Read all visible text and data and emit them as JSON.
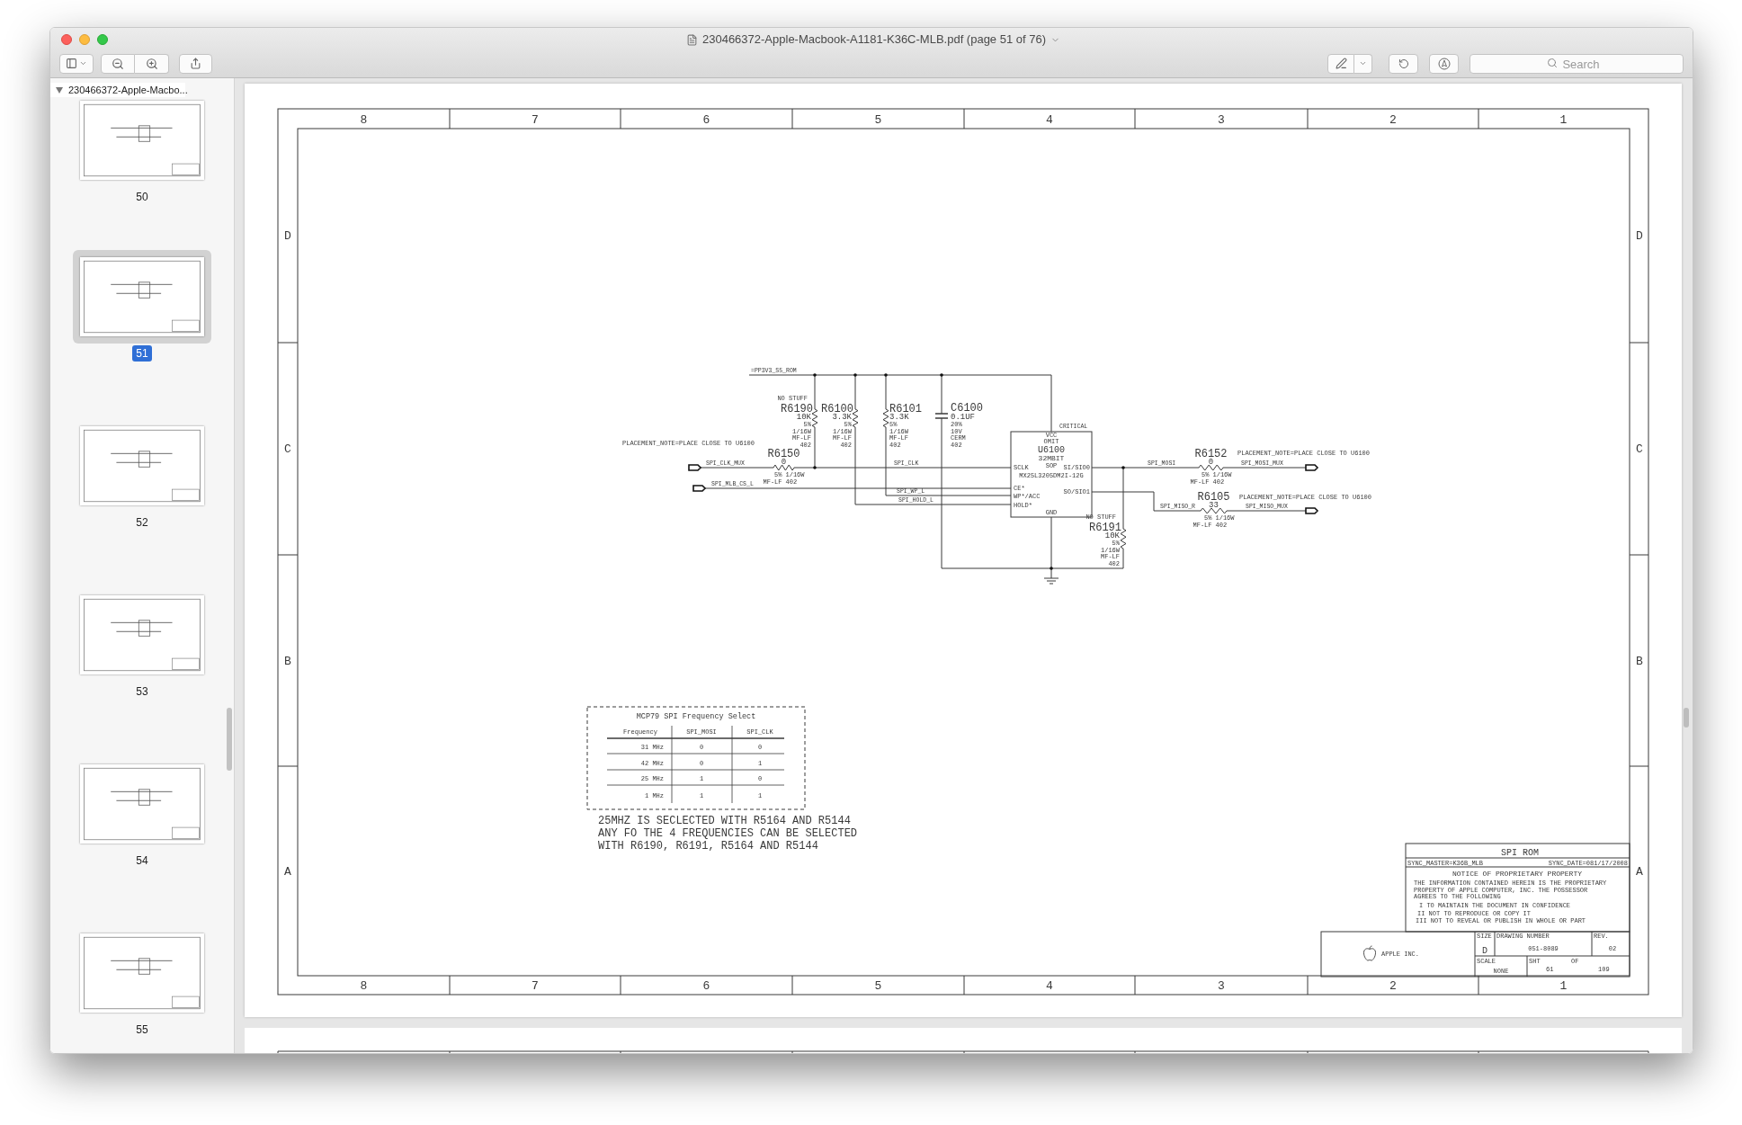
{
  "window": {
    "title": "230466372-Apple-Macbook-A1181-K36C-MLB.pdf (page 51 of 76)"
  },
  "toolbar": {
    "search": {
      "placeholder": "Search"
    }
  },
  "sidebar": {
    "document": "230466372-Apple-Macbo...",
    "pages": [
      {
        "label": "50",
        "selected": false
      },
      {
        "label": "51",
        "selected": true
      },
      {
        "label": "52",
        "selected": false
      },
      {
        "label": "53",
        "selected": false
      },
      {
        "label": "54",
        "selected": false
      },
      {
        "label": "55",
        "selected": false
      }
    ]
  },
  "sheet": {
    "top_zones": [
      "8",
      "7",
      "6",
      "5",
      "4",
      "3",
      "2",
      "1"
    ],
    "bottom_zones": [
      "8",
      "7",
      "6",
      "5",
      "4",
      "3",
      "2",
      "1"
    ],
    "left_zones": [
      "D",
      "C",
      "B",
      "A"
    ],
    "right_zones": [
      "D",
      "C",
      "B",
      "A"
    ]
  },
  "schematic": {
    "nets": [
      "=PP3V3_S5_ROM",
      "SPI_CLK_MUX",
      "SPI_MLB_CS_L",
      "SPI_CLK",
      "SPI_WP_L",
      "SPI_HOLD_L",
      "SPI_MOSI",
      "SPI_MOSI_MUX",
      "SPI_MISO_R",
      "SPI_MISO_MUX"
    ],
    "placement_notes": [
      "PLACEMENT_NOTE=PLACE CLOSE TO U6100",
      "PLACEMENT_NOTE=PLACE CLOSE TO U6100",
      "PLACEMENT_NOTE=PLACE CLOSE TO U6100"
    ],
    "components": [
      {
        "kind": "resistor",
        "ref": "R6190",
        "note": "NO STUFF",
        "value": "10K",
        "specs": [
          "5%",
          "1/16W",
          "MF-LF",
          "402"
        ]
      },
      {
        "kind": "resistor",
        "ref": "R6100",
        "value": "3.3K",
        "specs": [
          "5%",
          "1/16W",
          "MF-LF",
          "402"
        ]
      },
      {
        "kind": "resistor",
        "ref": "R6101",
        "value": "3.3K",
        "specs": [
          "5%",
          "1/16W",
          "MF-LF",
          "402"
        ]
      },
      {
        "kind": "capacitor",
        "ref": "C6100",
        "value": "0.1UF",
        "specs": [
          "20%",
          "10V",
          "CERM",
          "402"
        ]
      },
      {
        "kind": "resistor",
        "ref": "R6150",
        "value": "0",
        "specs": [
          "5%",
          "1/16W",
          "MF-LF",
          "402"
        ]
      },
      {
        "kind": "resistor",
        "ref": "R6152",
        "value": "0",
        "specs": [
          "5%",
          "1/16W",
          "MF-LF",
          "402"
        ]
      },
      {
        "kind": "resistor",
        "ref": "R6105",
        "value": "33",
        "specs": [
          "5%",
          "1/16W",
          "MF-LF",
          "402"
        ]
      },
      {
        "kind": "resistor",
        "ref": "R6191",
        "note": "NO STUFF",
        "value": "10K",
        "specs": [
          "5%",
          "1/16W",
          "MF-LF",
          "402"
        ]
      }
    ],
    "chip": {
      "ref": "U6100",
      "tag": "CRITICAL",
      "supply": "VCC",
      "omit": "OMIT",
      "size": "32MBIT",
      "package": "SOP",
      "part": "MX25L3205DM2I-12G",
      "ground": "GND",
      "left_pins": [
        "SCLK",
        "CE*",
        "WP*/ACC",
        "HOLD*"
      ],
      "right_pins": [
        "SI/SIO0",
        "SO/SIO1"
      ]
    }
  },
  "table": {
    "title": "MCP79 SPI Frequency Select",
    "columns": [
      "Frequency",
      "SPI_MOSI",
      "SPI_CLK"
    ],
    "rows": [
      [
        "31 MHz",
        "0",
        "0"
      ],
      [
        "42 MHz",
        "0",
        "1"
      ],
      [
        "25 MHz",
        "1",
        "0"
      ],
      [
        "1 MHz",
        "1",
        "1"
      ]
    ]
  },
  "notes": [
    "25MHZ IS SECLECTED WITH R5164 AND R5144",
    "ANY FO THE 4 FREQUENCIES CAN BE SELECTED",
    "WITH R6190, R6191, R5164 AND R5144"
  ],
  "title_block": {
    "title": "SPI ROM",
    "sync_master": "SYNC_MASTER=K36B_MLB",
    "sync_date": "SYNC_DATE=081/17/2008",
    "notice_title": "NOTICE OF PROPRIETARY PROPERTY",
    "notice_lines": [
      "THE INFORMATION CONTAINED HEREIN IS THE PROPRIETARY",
      "PROPERTY OF APPLE COMPUTER, INC. THE POSSESSOR",
      "AGREES TO THE FOLLOWING"
    ],
    "terms": [
      "I TO MAINTAIN THE DOCUMENT IN CONFIDENCE",
      "II NOT TO REPRODUCE OR COPY IT",
      "III NOT TO REVEAL OR PUBLISH IN WHOLE OR PART"
    ],
    "company": "APPLE INC.",
    "size_label": "SIZE",
    "size": "D",
    "drawing_number_label": "DRAWING NUMBER",
    "drawing_number": "051-8089",
    "rev_label": "REV.",
    "rev": "02",
    "scale_label": "SCALE",
    "scale": "NONE",
    "sheet_label": "SHT",
    "sheet": "61",
    "of_label": "OF",
    "of": "109"
  }
}
